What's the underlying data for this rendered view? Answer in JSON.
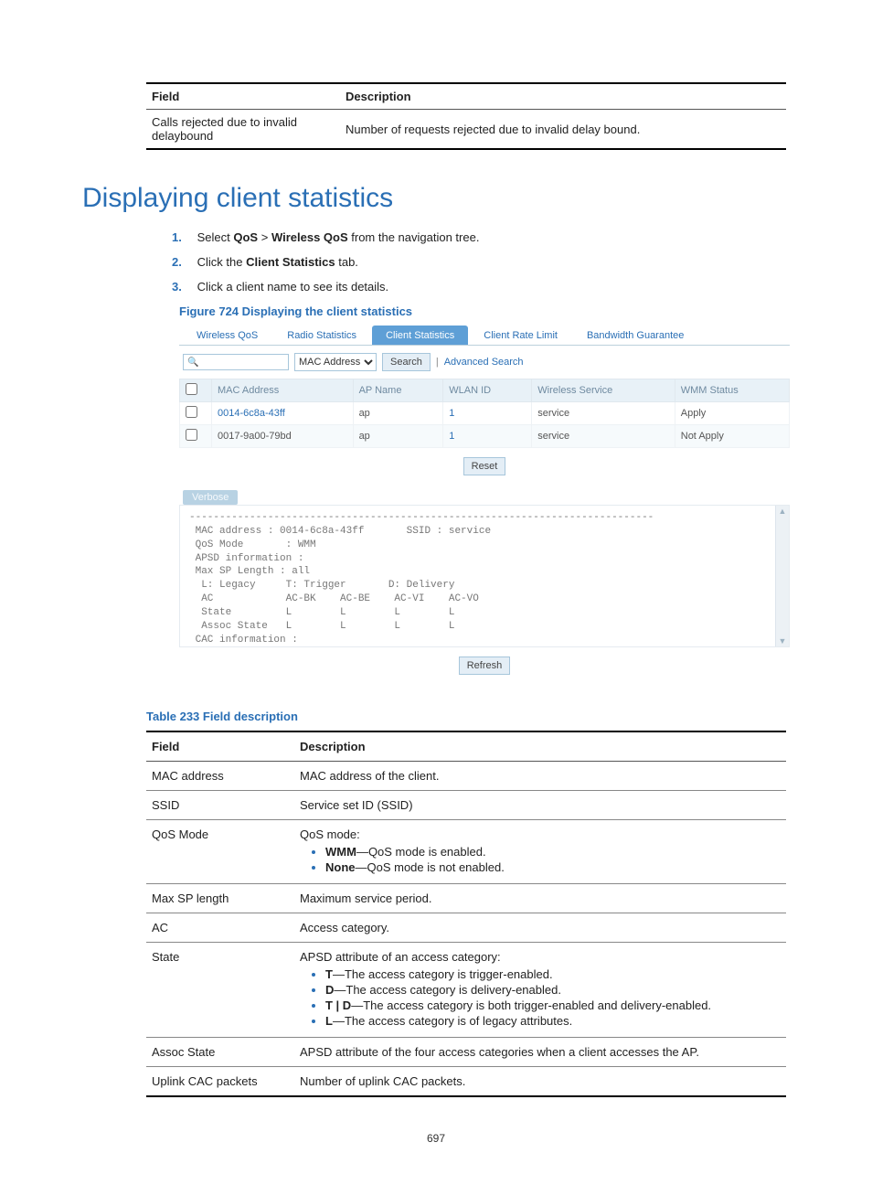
{
  "top_table": {
    "headers": {
      "field": "Field",
      "description": "Description"
    },
    "row": {
      "field": "Calls rejected due to invalid delaybound",
      "description": "Number of requests rejected due to invalid delay bound."
    }
  },
  "section_title": "Displaying client statistics",
  "steps": {
    "s1_pre": "Select ",
    "s1_b1": "QoS",
    "s1_mid": " > ",
    "s1_b2": "Wireless QoS",
    "s1_post": " from the navigation tree.",
    "s2_pre": "Click the ",
    "s2_b1": "Client Statistics",
    "s2_post": " tab.",
    "s3": "Click a client name to see its details."
  },
  "figure_caption": "Figure 724 Displaying the client statistics",
  "shot": {
    "tabs": [
      "Wireless QoS",
      "Radio Statistics",
      "Client Statistics",
      "Client Rate Limit",
      "Bandwidth Guarantee"
    ],
    "search": {
      "dropdown": "MAC Address",
      "search_btn": "Search",
      "advanced": "Advanced Search"
    },
    "grid": {
      "headers": [
        "MAC Address",
        "AP Name",
        "WLAN ID",
        "Wireless Service",
        "WMM Status"
      ],
      "rows": [
        {
          "mac": "0014-6c8a-43ff",
          "ap": "ap",
          "wlan": "1",
          "svc": "service",
          "wmm": "Apply",
          "link": true
        },
        {
          "mac": "0017-9a00-79bd",
          "ap": "ap",
          "wlan": "1",
          "svc": "service",
          "wmm": "Not Apply",
          "link": false
        }
      ]
    },
    "reset_btn": "Reset",
    "verbose_label": "Verbose",
    "verbose_text": "-----------------------------------------------------------------------------\n MAC address : 0014-6c8a-43ff       SSID : service\n QoS Mode       : WMM\n APSD information :\n Max SP Length : all\n  L: Legacy     T: Trigger       D: Delivery\n  AC            AC-BK    AC-BE    AC-VI    AC-VO\n  State         L        L        L        L\n  Assoc State   L        L        L        L\n CAC information :\n",
    "refresh_btn": "Refresh"
  },
  "table233_caption": "Table 233 Field description",
  "table233": {
    "headers": {
      "field": "Field",
      "description": "Description"
    },
    "rows": {
      "r0": {
        "field": "MAC address",
        "desc": "MAC address of the client."
      },
      "r1": {
        "field": "SSID",
        "desc": "Service set ID (SSID)"
      },
      "r2": {
        "field": "QoS Mode",
        "intro": "QoS mode:",
        "b1k": "WMM",
        "b1t": "—QoS mode is enabled.",
        "b2k": "None",
        "b2t": "—QoS mode is not enabled."
      },
      "r3": {
        "field": "Max SP length",
        "desc": "Maximum service period."
      },
      "r4": {
        "field": "AC",
        "desc": "Access category."
      },
      "r5": {
        "field": "State",
        "intro": "APSD attribute of an access category:",
        "b1k": "T",
        "b1t": "—The access category is trigger-enabled.",
        "b2k": "D",
        "b2t": "—The access category is delivery-enabled.",
        "b3k": "T | D",
        "b3t": "—The access category is both trigger-enabled and delivery-enabled.",
        "b4k": "L",
        "b4t": "—The access category is of legacy attributes."
      },
      "r6": {
        "field": "Assoc State",
        "desc": "APSD attribute of the four access categories when a client accesses the AP."
      },
      "r7": {
        "field": "Uplink CAC packets",
        "desc": "Number of uplink CAC packets."
      }
    }
  },
  "page_number": "697"
}
